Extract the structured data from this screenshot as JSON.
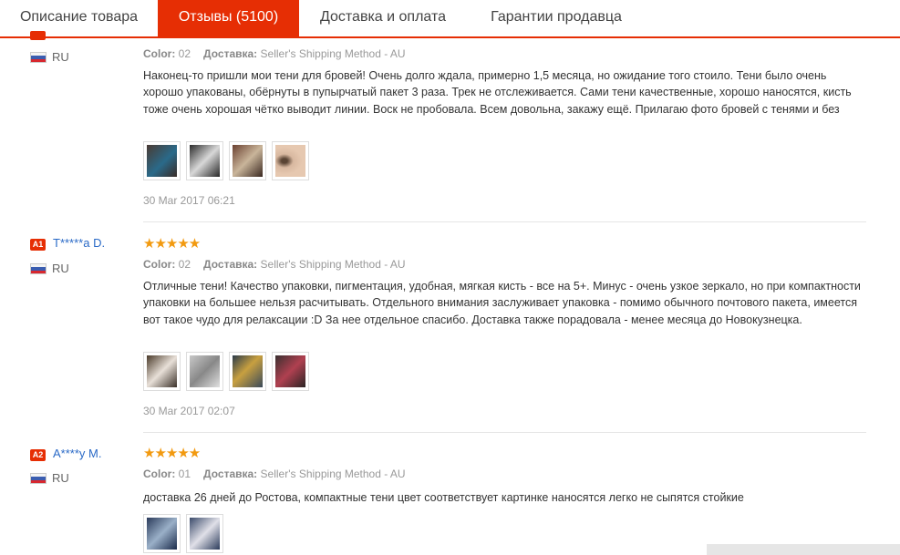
{
  "tabs": [
    {
      "label": "Описание товара"
    },
    {
      "label": "Отзывы (5100)"
    },
    {
      "label": "Доставка и оплата"
    },
    {
      "label": "Гарантии продавца"
    }
  ],
  "colors": {
    "accent": "#e62e04",
    "star": "#f29a10",
    "link": "#2a6ac7"
  },
  "labels": {
    "color": "Color:",
    "shipping": "Доставка:"
  },
  "reviews": [
    {
      "badge": "",
      "username": "",
      "country": "RU",
      "stars": "",
      "color_value": "02",
      "shipping_value": "Seller's Shipping Method - AU",
      "text": "Наконец-то пришли мои тени для бровей! Очень долго ждала, примерно 1,5 месяца, но ожидание того стоило. Тени было очень хорошо упакованы, обёрнуты в пупырчатый пакет 3 раза. Трек не отслеживается. Сами тени качественные, хорошо наносятся, кисть тоже очень хорошая чётко выводит линии. Воск не пробовала. Всем довольна, закажу ещё. Прилагаю фото бровей с тенями и без",
      "date": "30 Mar 2017 06:21",
      "photos": 4
    },
    {
      "badge": "A1",
      "username": "T*****a D.",
      "country": "RU",
      "stars": "★★★★★",
      "color_value": "02",
      "shipping_value": "Seller's Shipping Method - AU",
      "text": "Отличные тени! Качество упаковки, пигментация, удобная, мягкая кисть - все на 5+. Минус - очень узкое зеркало, но при компактности упаковки на большее нельзя расчитывать. Отдельного внимания заслуживает упаковка - помимо обычного почтового пакета, имеется вот такое чудо для релаксации :D За нее отдельное спасибо. Доставка также порадовала - менее месяца до Новокузнецка.",
      "date": "30 Mar 2017 02:07",
      "photos": 4
    },
    {
      "badge": "A2",
      "username": "A****y M.",
      "country": "RU",
      "stars": "★★★★★",
      "color_value": "01",
      "shipping_value": "Seller's Shipping Method - AU",
      "text": "доставка 26 дней до Ростова, компактные тени цвет соответствует картинке наносятся легко не сыпятся стойкие",
      "date": "",
      "photos": 2
    }
  ]
}
